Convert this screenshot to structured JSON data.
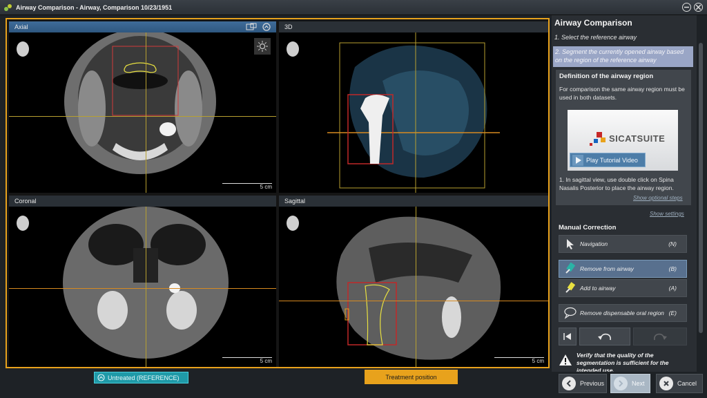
{
  "window": {
    "title": "Airway Comparison - Airway, Comparison 10/23/1951"
  },
  "viewports": {
    "axial": {
      "label": "Axial",
      "scale": "5 cm"
    },
    "view3d": {
      "label": "3D"
    },
    "coronal": {
      "label": "Coronal",
      "scale": "5 cm"
    },
    "sagittal": {
      "label": "Sagittal",
      "scale": "5 cm"
    }
  },
  "bottom": {
    "status_label": "Untreated (REFERENCE)",
    "treatment_label": "Treatment position"
  },
  "panel": {
    "title": "Airway Comparison",
    "step1": "1. Select the reference airway",
    "step2": "2. Segment the currently opened airway based on the region of the reference airway",
    "definition": {
      "title": "Definition of the airway region",
      "text": "For comparison the same airway region must be used in both datasets.",
      "logo": "SICATSUITE",
      "play_label": "Play Tutorial Video",
      "instruction": "1. In sagittal view, use double click on Spina Nasalis Posterior to place the airway region.",
      "optional_link": "Show optional steps"
    },
    "settings_link": "Show settings",
    "manual_correction": {
      "title": "Manual Correction",
      "tools": [
        {
          "label": "Navigation",
          "key": "(N)",
          "icon": "cursor-icon"
        },
        {
          "label": "Remove from airway",
          "key": "(B)",
          "icon": "eraser-icon"
        },
        {
          "label": "Add to airway",
          "key": "(A)",
          "icon": "brush-icon"
        },
        {
          "label": "Remove dispensable oral region",
          "key": "(E)",
          "icon": "speech-bubble-icon"
        }
      ]
    },
    "warning": "Verify that the quality of the segmentation is sufficient for the intended use."
  },
  "nav": {
    "previous": "Previous",
    "next": "Next",
    "cancel": "Cancel"
  },
  "colors": {
    "accent_orange": "#e8a21c",
    "teal": "#1f9aa8",
    "active_header": "#3f6c9a"
  }
}
